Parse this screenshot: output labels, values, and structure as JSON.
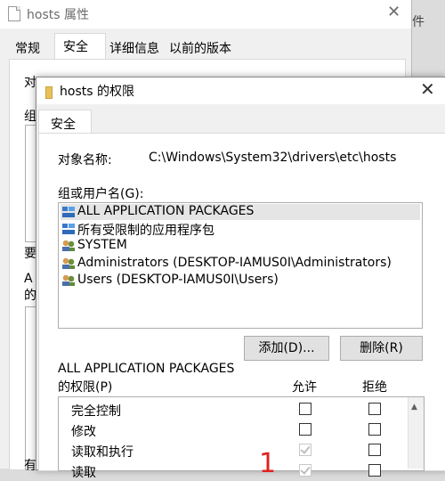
{
  "background_window": {
    "title": "hosts 属性",
    "tabs": [
      "常规",
      "安全",
      "详细信息",
      "以前的版本"
    ],
    "active_tab": 1,
    "partial_texts": [
      "对",
      "组",
      "要",
      "A",
      "的",
      "有"
    ],
    "right_fragment": "件"
  },
  "dialog": {
    "title": "hosts 的权限",
    "tab": "安全",
    "object_name_label": "对象名称:",
    "object_name_value": "C:\\Windows\\System32\\drivers\\etc\\hosts",
    "group_label": "组或用户名(G):",
    "users": [
      {
        "name": "ALL APPLICATION PACKAGES",
        "icon": "package-group-icon",
        "selected": true
      },
      {
        "name": "所有受限制的应用程序包",
        "icon": "package-group-icon",
        "selected": false
      },
      {
        "name": "SYSTEM",
        "icon": "users-group-icon",
        "selected": false
      },
      {
        "name": "Administrators (DESKTOP-IAMUS0I\\Administrators)",
        "icon": "users-group-icon",
        "selected": false
      },
      {
        "name": "Users (DESKTOP-IAMUS0I\\Users)",
        "icon": "users-group-icon",
        "selected": false
      }
    ],
    "add_button": "添加(D)...",
    "remove_button": "删除(R)",
    "permissions_for_line1": "ALL APPLICATION PACKAGES",
    "permissions_for_line2": "的权限(P)",
    "allow_header": "允许",
    "deny_header": "拒绝",
    "permissions": [
      {
        "label": "完全控制",
        "allow": false,
        "deny": false,
        "allow_disabled": false
      },
      {
        "label": "修改",
        "allow": false,
        "deny": false,
        "allow_disabled": false
      },
      {
        "label": "读取和执行",
        "allow": true,
        "deny": false,
        "allow_disabled": true
      },
      {
        "label": "读取",
        "allow": true,
        "deny": false,
        "allow_disabled": true
      }
    ],
    "annotation_marker": "1"
  }
}
